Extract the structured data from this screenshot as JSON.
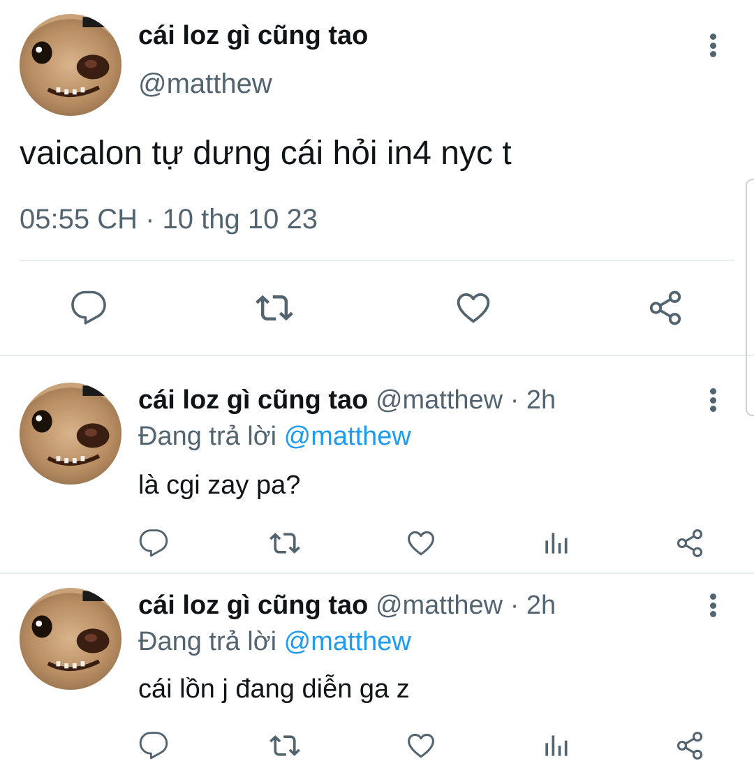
{
  "main_tweet": {
    "display_name": "cái loz gì cũng tao",
    "handle": "@matthew",
    "text": "vaicalon tự dưng cái hỏi in4 nyc t",
    "timestamp": "05:55 CH · 10 thg 10 23",
    "avatar_badge": "#co",
    "actions": [
      "reply-icon",
      "retweet-icon",
      "like-icon",
      "share-icon"
    ]
  },
  "replies": [
    {
      "display_name": "cái loz gì cũng tao",
      "handle": "@matthew",
      "time": "· 2h",
      "replying_label": "Đang trả lời",
      "replying_to": "@matthew",
      "text": "là cgi zay pa?",
      "avatar_badge": "#co"
    },
    {
      "display_name": "cái loz gì cũng tao",
      "handle": "@matthew",
      "time": "· 2h",
      "replying_label": "Đang trả lời",
      "replying_to": "@matthew",
      "text": "cái lồn j đang diễn ga z",
      "avatar_badge": "#co"
    }
  ],
  "colors": {
    "text": "#0f1419",
    "secondary": "#536471",
    "accent": "#1d9bf0",
    "divider": "#e6ecf0"
  }
}
